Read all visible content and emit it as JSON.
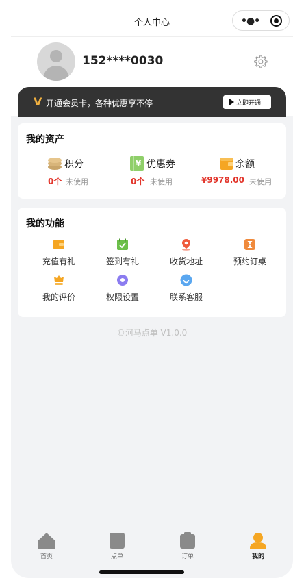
{
  "nav": {
    "title": "个人中心"
  },
  "profile": {
    "phone": "152****0030"
  },
  "vip_banner": {
    "badge": "V",
    "text": "开通会员卡，各种优惠享不停",
    "button_label": "立即开通"
  },
  "assets": {
    "title": "我的资产",
    "items": [
      {
        "icon": "coins-icon",
        "name": "积分",
        "value": "0个",
        "sub": "未使用"
      },
      {
        "icon": "coupon-icon",
        "name": "优惠券",
        "value": "0个",
        "sub": "未使用"
      },
      {
        "icon": "wallet-icon",
        "name": "余额",
        "value": "¥9978.00",
        "sub": "未使用"
      }
    ]
  },
  "functions": {
    "title": "我的功能",
    "items": [
      {
        "icon": "recharge-icon",
        "label": "充值有礼"
      },
      {
        "icon": "checkin-icon",
        "label": "签到有礼"
      },
      {
        "icon": "location-icon",
        "label": "收货地址"
      },
      {
        "icon": "hourglass-icon",
        "label": "预约订桌"
      },
      {
        "icon": "review-icon",
        "label": "我的评价"
      },
      {
        "icon": "permission-icon",
        "label": "权限设置"
      },
      {
        "icon": "service-icon",
        "label": "联系客服"
      }
    ]
  },
  "footer": {
    "copyright": "©河马点单 V1.0.0"
  },
  "tabbar": {
    "items": [
      {
        "label": "首页",
        "icon": "home-icon"
      },
      {
        "label": "点单",
        "icon": "order-menu-icon"
      },
      {
        "label": "订单",
        "icon": "orders-icon"
      },
      {
        "label": "我的",
        "icon": "user-icon"
      }
    ],
    "active": "我的"
  },
  "colors": {
    "accent": "#f5a623",
    "price": "#e2352b",
    "vip_bg": "#333333"
  }
}
